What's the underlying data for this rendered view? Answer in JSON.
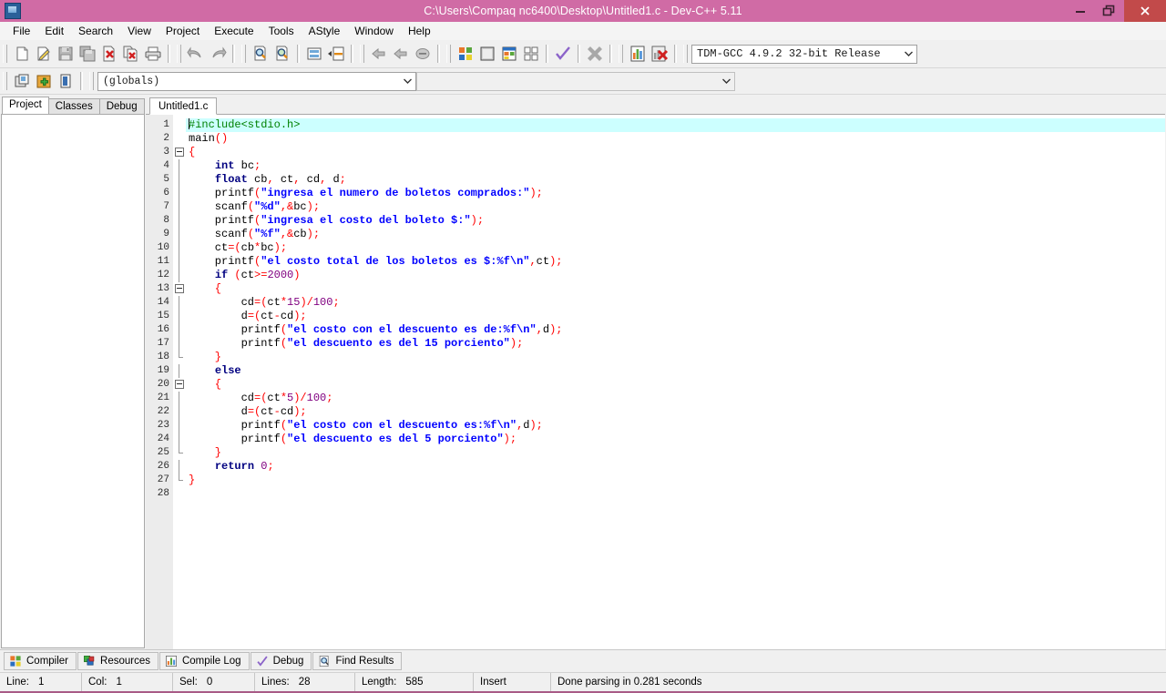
{
  "window": {
    "title": "C:\\Users\\Compaq nc6400\\Desktop\\Untitled1.c - Dev-C++ 5.11",
    "minimize_label": "Minimize",
    "restore_label": "Restore",
    "close_label": "Close",
    "titlebar_color": "#d06ba5",
    "close_button_color": "#c24a4a"
  },
  "menubar": {
    "items": [
      {
        "label": "File"
      },
      {
        "label": "Edit"
      },
      {
        "label": "Search"
      },
      {
        "label": "View"
      },
      {
        "label": "Project"
      },
      {
        "label": "Execute"
      },
      {
        "label": "Tools"
      },
      {
        "label": "AStyle"
      },
      {
        "label": "Window"
      },
      {
        "label": "Help"
      }
    ]
  },
  "toolbar": {
    "compiler_select": "TDM-GCC 4.9.2 32-bit Release",
    "scope_select": "(globals)",
    "buttons": [
      "new-file",
      "open-file",
      "save-file",
      "save-all",
      "close-file",
      "close-all",
      "print",
      "undo",
      "redo",
      "find",
      "replace",
      "goto-line",
      "goto-function",
      "back",
      "forward",
      "toggle-breakpoint",
      "compile",
      "run",
      "compile-run",
      "rebuild-all",
      "syntax-check",
      "stop-execution",
      "profile-analysis",
      "delete-profile"
    ]
  },
  "left_panel": {
    "tabs": [
      {
        "label": "Project",
        "active": true
      },
      {
        "label": "Classes",
        "active": false
      },
      {
        "label": "Debug",
        "active": false
      }
    ]
  },
  "editor": {
    "tabs": [
      {
        "label": "Untitled1.c",
        "active": true
      }
    ],
    "total_lines": 28,
    "active_line": 1,
    "lines": [
      {
        "num": 1,
        "fold": "none",
        "active": true,
        "tokens": [
          {
            "t": "caret",
            "v": ""
          },
          {
            "t": "pre",
            "v": "#include<stdio.h>"
          }
        ]
      },
      {
        "num": 2,
        "fold": "none",
        "tokens": [
          {
            "t": "id",
            "v": "main"
          },
          {
            "t": "p",
            "v": "()"
          }
        ]
      },
      {
        "num": 3,
        "fold": "open",
        "tokens": [
          {
            "t": "p",
            "v": "{"
          }
        ]
      },
      {
        "num": 4,
        "fold": "line",
        "tokens": [
          {
            "t": "id",
            "v": "    "
          },
          {
            "t": "k",
            "v": "int"
          },
          {
            "t": "id",
            "v": " bc"
          },
          {
            "t": "p",
            "v": ";"
          }
        ]
      },
      {
        "num": 5,
        "fold": "line",
        "tokens": [
          {
            "t": "id",
            "v": "    "
          },
          {
            "t": "k",
            "v": "float"
          },
          {
            "t": "id",
            "v": " cb"
          },
          {
            "t": "p",
            "v": ","
          },
          {
            "t": "id",
            "v": " ct"
          },
          {
            "t": "p",
            "v": ","
          },
          {
            "t": "id",
            "v": " cd"
          },
          {
            "t": "p",
            "v": ","
          },
          {
            "t": "id",
            "v": " d"
          },
          {
            "t": "p",
            "v": ";"
          }
        ]
      },
      {
        "num": 6,
        "fold": "line",
        "tokens": [
          {
            "t": "id",
            "v": "    printf"
          },
          {
            "t": "p",
            "v": "("
          },
          {
            "t": "s",
            "v": "\"ingresa el numero de boletos comprados:\""
          },
          {
            "t": "p",
            "v": ");"
          }
        ]
      },
      {
        "num": 7,
        "fold": "line",
        "tokens": [
          {
            "t": "id",
            "v": "    scanf"
          },
          {
            "t": "p",
            "v": "("
          },
          {
            "t": "s",
            "v": "\"%d\""
          },
          {
            "t": "p",
            "v": ",&"
          },
          {
            "t": "id",
            "v": "bc"
          },
          {
            "t": "p",
            "v": ");"
          }
        ]
      },
      {
        "num": 8,
        "fold": "line",
        "tokens": [
          {
            "t": "id",
            "v": "    printf"
          },
          {
            "t": "p",
            "v": "("
          },
          {
            "t": "s",
            "v": "\"ingresa el costo del boleto $:\""
          },
          {
            "t": "p",
            "v": ");"
          }
        ]
      },
      {
        "num": 9,
        "fold": "line",
        "tokens": [
          {
            "t": "id",
            "v": "    scanf"
          },
          {
            "t": "p",
            "v": "("
          },
          {
            "t": "s",
            "v": "\"%f\""
          },
          {
            "t": "p",
            "v": ",&"
          },
          {
            "t": "id",
            "v": "cb"
          },
          {
            "t": "p",
            "v": ");"
          }
        ]
      },
      {
        "num": 10,
        "fold": "line",
        "tokens": [
          {
            "t": "id",
            "v": "    ct"
          },
          {
            "t": "p",
            "v": "=("
          },
          {
            "t": "id",
            "v": "cb"
          },
          {
            "t": "p",
            "v": "*"
          },
          {
            "t": "id",
            "v": "bc"
          },
          {
            "t": "p",
            "v": ");"
          }
        ]
      },
      {
        "num": 11,
        "fold": "line",
        "tokens": [
          {
            "t": "id",
            "v": "    printf"
          },
          {
            "t": "p",
            "v": "("
          },
          {
            "t": "s",
            "v": "\"el costo total de los boletos es $:%f\\n\""
          },
          {
            "t": "p",
            "v": ","
          },
          {
            "t": "id",
            "v": "ct"
          },
          {
            "t": "p",
            "v": ");"
          }
        ]
      },
      {
        "num": 12,
        "fold": "line",
        "tokens": [
          {
            "t": "id",
            "v": "    "
          },
          {
            "t": "k",
            "v": "if"
          },
          {
            "t": "id",
            "v": " "
          },
          {
            "t": "p",
            "v": "("
          },
          {
            "t": "id",
            "v": "ct"
          },
          {
            "t": "p",
            "v": ">="
          },
          {
            "t": "n",
            "v": "2000"
          },
          {
            "t": "p",
            "v": ")"
          }
        ]
      },
      {
        "num": 13,
        "fold": "open2",
        "tokens": [
          {
            "t": "p",
            "v": "    {"
          }
        ]
      },
      {
        "num": 14,
        "fold": "line2",
        "tokens": [
          {
            "t": "id",
            "v": "        cd"
          },
          {
            "t": "p",
            "v": "=("
          },
          {
            "t": "id",
            "v": "ct"
          },
          {
            "t": "p",
            "v": "*"
          },
          {
            "t": "n",
            "v": "15"
          },
          {
            "t": "p",
            "v": ")/"
          },
          {
            "t": "n",
            "v": "100"
          },
          {
            "t": "p",
            "v": ";"
          }
        ]
      },
      {
        "num": 15,
        "fold": "line2",
        "tokens": [
          {
            "t": "id",
            "v": "        d"
          },
          {
            "t": "p",
            "v": "=("
          },
          {
            "t": "id",
            "v": "ct"
          },
          {
            "t": "p",
            "v": "-"
          },
          {
            "t": "id",
            "v": "cd"
          },
          {
            "t": "p",
            "v": ");"
          }
        ]
      },
      {
        "num": 16,
        "fold": "line2",
        "tokens": [
          {
            "t": "id",
            "v": "        printf"
          },
          {
            "t": "p",
            "v": "("
          },
          {
            "t": "s",
            "v": "\"el costo con el descuento es de:%f\\n\""
          },
          {
            "t": "p",
            "v": ","
          },
          {
            "t": "id",
            "v": "d"
          },
          {
            "t": "p",
            "v": ");"
          }
        ]
      },
      {
        "num": 17,
        "fold": "line2",
        "tokens": [
          {
            "t": "id",
            "v": "        printf"
          },
          {
            "t": "p",
            "v": "("
          },
          {
            "t": "s",
            "v": "\"el descuento es del 15 porciento\""
          },
          {
            "t": "p",
            "v": ");"
          }
        ]
      },
      {
        "num": 18,
        "fold": "end2",
        "tokens": [
          {
            "t": "p",
            "v": "    }"
          }
        ]
      },
      {
        "num": 19,
        "fold": "line",
        "tokens": [
          {
            "t": "id",
            "v": "    "
          },
          {
            "t": "k",
            "v": "else"
          }
        ]
      },
      {
        "num": 20,
        "fold": "open2",
        "tokens": [
          {
            "t": "p",
            "v": "    {"
          }
        ]
      },
      {
        "num": 21,
        "fold": "line2",
        "tokens": [
          {
            "t": "id",
            "v": "        cd"
          },
          {
            "t": "p",
            "v": "=("
          },
          {
            "t": "id",
            "v": "ct"
          },
          {
            "t": "p",
            "v": "*"
          },
          {
            "t": "n",
            "v": "5"
          },
          {
            "t": "p",
            "v": ")/"
          },
          {
            "t": "n",
            "v": "100"
          },
          {
            "t": "p",
            "v": ";"
          }
        ]
      },
      {
        "num": 22,
        "fold": "line2",
        "tokens": [
          {
            "t": "id",
            "v": "        d"
          },
          {
            "t": "p",
            "v": "=("
          },
          {
            "t": "id",
            "v": "ct"
          },
          {
            "t": "p",
            "v": "-"
          },
          {
            "t": "id",
            "v": "cd"
          },
          {
            "t": "p",
            "v": ");"
          }
        ]
      },
      {
        "num": 23,
        "fold": "line2",
        "tokens": [
          {
            "t": "id",
            "v": "        printf"
          },
          {
            "t": "p",
            "v": "("
          },
          {
            "t": "s",
            "v": "\"el costo con el descuento es:%f\\n\""
          },
          {
            "t": "p",
            "v": ","
          },
          {
            "t": "id",
            "v": "d"
          },
          {
            "t": "p",
            "v": ");"
          }
        ]
      },
      {
        "num": 24,
        "fold": "line2",
        "tokens": [
          {
            "t": "id",
            "v": "        printf"
          },
          {
            "t": "p",
            "v": "("
          },
          {
            "t": "s",
            "v": "\"el descuento es del 5 porciento\""
          },
          {
            "t": "p",
            "v": ");"
          }
        ]
      },
      {
        "num": 25,
        "fold": "end2",
        "tokens": [
          {
            "t": "p",
            "v": "    }"
          }
        ]
      },
      {
        "num": 26,
        "fold": "line",
        "tokens": [
          {
            "t": "id",
            "v": "    "
          },
          {
            "t": "k",
            "v": "return"
          },
          {
            "t": "id",
            "v": " "
          },
          {
            "t": "n",
            "v": "0"
          },
          {
            "t": "p",
            "v": ";"
          }
        ]
      },
      {
        "num": 27,
        "fold": "end",
        "tokens": [
          {
            "t": "p",
            "v": "}"
          }
        ]
      },
      {
        "num": 28,
        "fold": "none",
        "tokens": []
      }
    ]
  },
  "bottom_tabs": [
    {
      "label": "Compiler",
      "icon": "compiler-icon"
    },
    {
      "label": "Resources",
      "icon": "resources-icon"
    },
    {
      "label": "Compile Log",
      "icon": "compile-log-icon"
    },
    {
      "label": "Debug",
      "icon": "debug-icon"
    },
    {
      "label": "Find Results",
      "icon": "find-results-icon"
    }
  ],
  "statusbar": {
    "line_label": "Line:",
    "line_value": "1",
    "col_label": "Col:",
    "col_value": "1",
    "sel_label": "Sel:",
    "sel_value": "0",
    "lines_label": "Lines:",
    "lines_value": "28",
    "length_label": "Length:",
    "length_value": "585",
    "mode": "Insert",
    "message": "Done parsing in 0.281 seconds"
  }
}
